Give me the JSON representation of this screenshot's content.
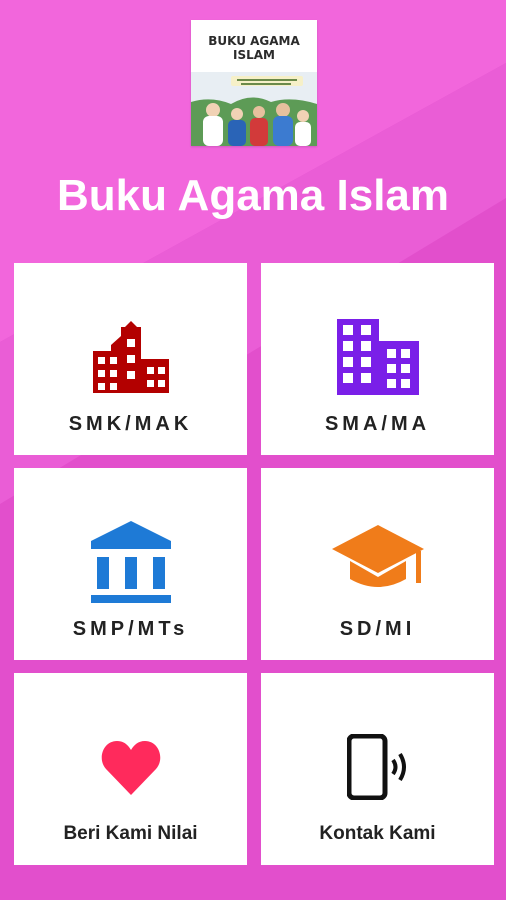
{
  "header": {
    "cover_title_line1": "BUKU AGAMA",
    "cover_title_line2": "ISLAM",
    "app_title": "Buku Agama Islam"
  },
  "menu": [
    {
      "label": "SMK/MAK",
      "icon": "school-building-icon",
      "color": "#b30000"
    },
    {
      "label": "SMA/MA",
      "icon": "office-building-icon",
      "color": "#7a1fe8"
    },
    {
      "label": "SMP/MTs",
      "icon": "institution-icon",
      "color": "#1e7ad6"
    },
    {
      "label": "SD/MI",
      "icon": "graduation-cap-icon",
      "color": "#f07c1a"
    },
    {
      "label": "Beri Kami Nilai",
      "icon": "heart-icon",
      "color": "#ff2a5c"
    },
    {
      "label": "Kontak Kami",
      "icon": "phone-vibrate-icon",
      "color": "#111111"
    }
  ]
}
